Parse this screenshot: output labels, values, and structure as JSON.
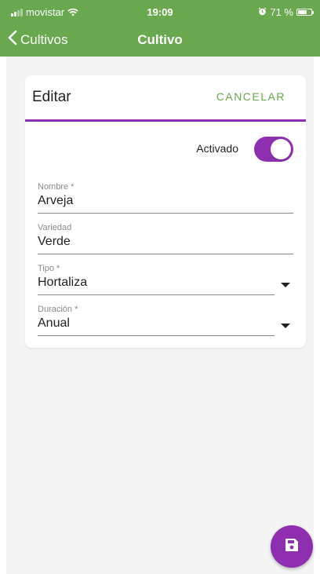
{
  "status_bar": {
    "carrier": "movistar",
    "time": "19:09",
    "battery": "71 %",
    "battery_level": 0.71,
    "icons": [
      "signal-icon",
      "wifi-icon",
      "alarm-icon",
      "battery-icon"
    ]
  },
  "nav": {
    "back_label": "Cultivos",
    "title": "Cultivo"
  },
  "form": {
    "title": "Editar",
    "cancel_label": "CANCELAR",
    "toggle": {
      "label": "Activado",
      "value": true
    },
    "fields": [
      {
        "label": "Nombre *",
        "value": "Arveja"
      },
      {
        "label": "Variedad",
        "value": "Verde"
      },
      {
        "label": "Tipo *",
        "value": "Hortaliza"
      },
      {
        "label": "Duración *",
        "value": "Anual"
      }
    ]
  },
  "fab": {
    "icon": "save-icon"
  },
  "colors": {
    "primary_green": "#6aa850",
    "accent_purple": "#8e2fb0",
    "background": "#f4f4f4"
  }
}
